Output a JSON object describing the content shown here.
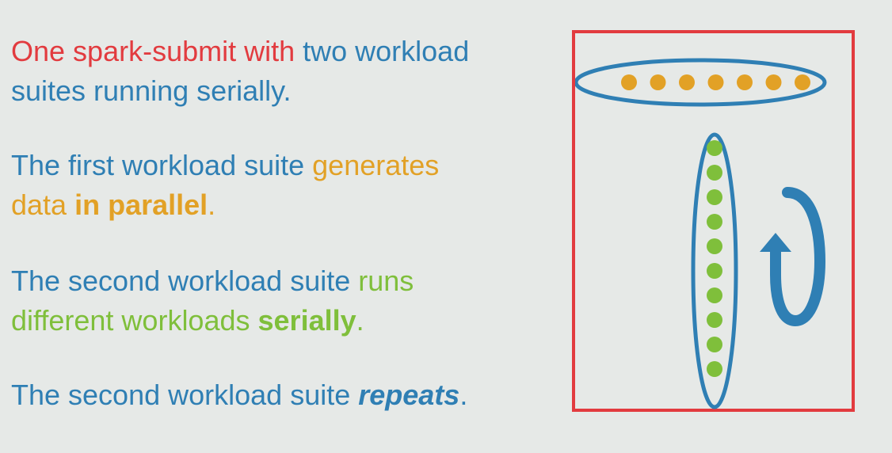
{
  "slide": {
    "paragraphs": [
      {
        "segments": [
          {
            "text": "One spark-submit with ",
            "color": "#e23b3f",
            "bold": false,
            "italic": false
          },
          {
            "text": "two workload",
            "color": "#2f7fb4",
            "bold": false,
            "italic": false
          },
          {
            "text": "BR",
            "color": "#2f7fb4",
            "bold": false,
            "italic": false
          },
          {
            "text": "suites running serially.",
            "color": "#2f7fb4",
            "bold": false,
            "italic": false
          }
        ]
      },
      {
        "segments": [
          {
            "text": "The first workload suite ",
            "color": "#2f7fb4",
            "bold": false,
            "italic": false
          },
          {
            "text": "generates",
            "color": "#e2a126",
            "bold": false,
            "italic": false
          },
          {
            "text": "BR",
            "color": "#2f7fb4",
            "bold": false,
            "italic": false
          },
          {
            "text": "data ",
            "color": "#e2a126",
            "bold": false,
            "italic": false
          },
          {
            "text": "in parallel",
            "color": "#e2a126",
            "bold": true,
            "italic": false
          },
          {
            "text": ".",
            "color": "#e2a126",
            "bold": false,
            "italic": false
          }
        ]
      },
      {
        "segments": [
          {
            "text": "The second workload suite ",
            "color": "#2f7fb4",
            "bold": false,
            "italic": false
          },
          {
            "text": "runs",
            "color": "#7fbf3b",
            "bold": false,
            "italic": false
          },
          {
            "text": "BR",
            "color": "#2f7fb4",
            "bold": false,
            "italic": false
          },
          {
            "text": "different workloads ",
            "color": "#7fbf3b",
            "bold": false,
            "italic": false
          },
          {
            "text": "serially",
            "color": "#7fbf3b",
            "bold": true,
            "italic": false
          },
          {
            "text": ".",
            "color": "#7fbf3b",
            "bold": false,
            "italic": false
          }
        ]
      },
      {
        "segments": [
          {
            "text": "The second workload suite ",
            "color": "#2f7fb4",
            "bold": false,
            "italic": false
          },
          {
            "text": "repeats",
            "color": "#2f7fb4",
            "bold": true,
            "italic": true
          },
          {
            "text": ".",
            "color": "#2f7fb4",
            "bold": false,
            "italic": false
          }
        ]
      }
    ]
  },
  "colors": {
    "background": "#e6e9e7",
    "red": "#e23b3f",
    "blue": "#2f7fb4",
    "orange": "#e2a126",
    "green": "#7fbf3b"
  },
  "diagram": {
    "parallel_suite_dots": 7,
    "serial_suite_dots": 10,
    "repeat_icon": "circular-repeat-arrow-icon"
  }
}
